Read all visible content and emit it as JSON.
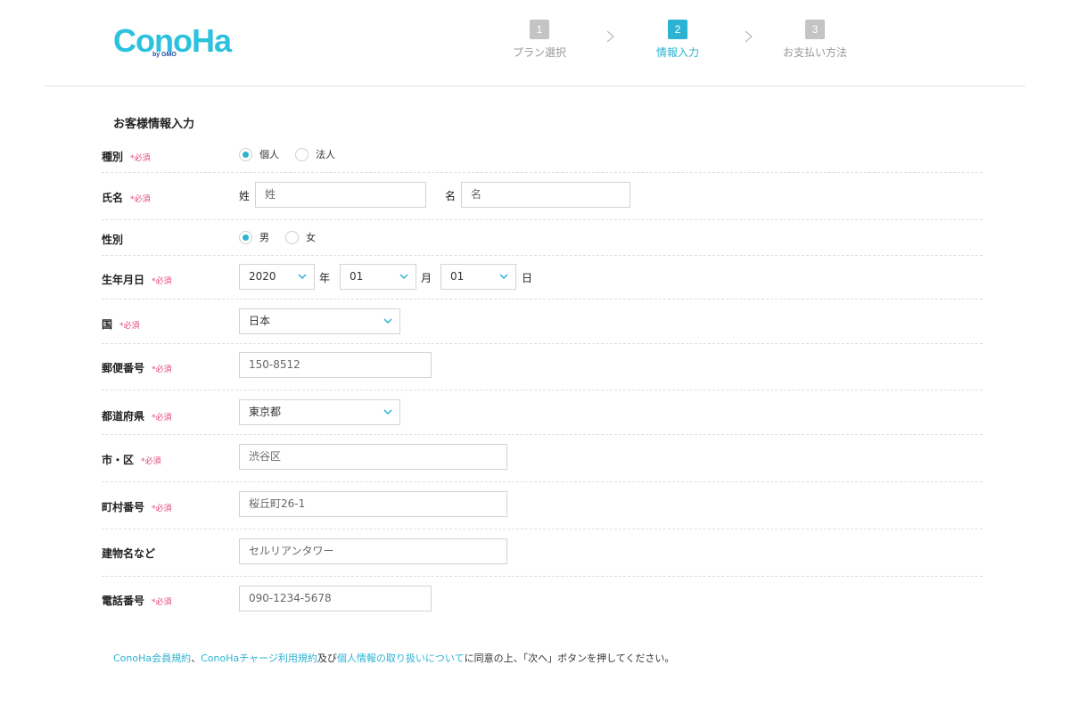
{
  "logo": {
    "text": "ConoHa",
    "sub": "by GMO",
    "color": "#2cc1de"
  },
  "steps": [
    {
      "num": "1",
      "label": "プラン選択",
      "active": false
    },
    {
      "num": "2",
      "label": "情報入力",
      "active": true
    },
    {
      "num": "3",
      "label": "お支払い方法",
      "active": false
    }
  ],
  "section_title": "お客様情報入力",
  "required_mark": "*必須",
  "form": {
    "type": {
      "label": "種別",
      "options": [
        "個人",
        "法人"
      ],
      "selected": "個人"
    },
    "name": {
      "label": "氏名",
      "last_label": "姓",
      "last_placeholder": "姓",
      "first_label": "名",
      "first_placeholder": "名"
    },
    "gender": {
      "label": "性別",
      "options": [
        "男",
        "女"
      ],
      "selected": "男"
    },
    "birth": {
      "label": "生年月日",
      "year": "2020",
      "year_unit": "年",
      "month": "01",
      "month_unit": "月",
      "day": "01",
      "day_unit": "日"
    },
    "country": {
      "label": "国",
      "value": "日本"
    },
    "postal": {
      "label": "郵便番号",
      "placeholder": "150-8512"
    },
    "prefecture": {
      "label": "都道府県",
      "value": "東京都"
    },
    "city": {
      "label": "市・区",
      "placeholder": "渋谷区"
    },
    "street": {
      "label": "町村番号",
      "placeholder": "桜丘町26-1"
    },
    "building": {
      "label": "建物名など",
      "placeholder": "セルリアンタワー"
    },
    "phone": {
      "label": "電話番号",
      "placeholder": "090-1234-5678"
    }
  },
  "consent": {
    "link1": "ConoHa会員規約",
    "sep1": "、",
    "link2": "ConoHaチャージ利用規約",
    "sep2": "及び",
    "link3": "個人情報の取り扱いについて",
    "rest": "に同意の上、「次へ」ボタンを押してください。"
  },
  "colors": {
    "accent": "#2cb3d2",
    "required": "#e0457b",
    "step_inactive": "#c4c4c4"
  }
}
